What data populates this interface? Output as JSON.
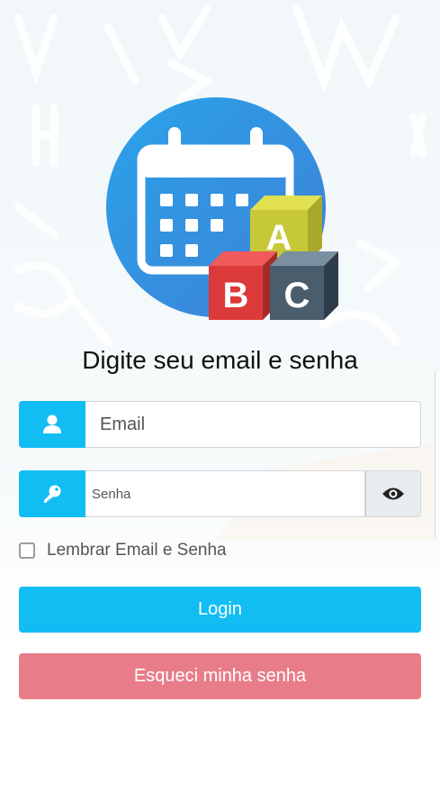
{
  "header": {
    "title": "Digite seu email e senha"
  },
  "logo": {
    "name": "calendar-abc-logo",
    "letters": [
      "A",
      "B",
      "C"
    ]
  },
  "form": {
    "email": {
      "placeholder": "Email",
      "value": "",
      "icon": "user-icon"
    },
    "password": {
      "placeholder": "Senha",
      "value": "",
      "icon": "key-icon",
      "toggle_icon": "eye-icon"
    },
    "remember": {
      "label": "Lembrar Email e Senha",
      "checked": false
    }
  },
  "buttons": {
    "login": "Login",
    "forgot": "Esqueci minha senha"
  },
  "colors": {
    "primary": "#12bdf4",
    "danger": "#e87d89",
    "background": "#f1f7fa"
  }
}
